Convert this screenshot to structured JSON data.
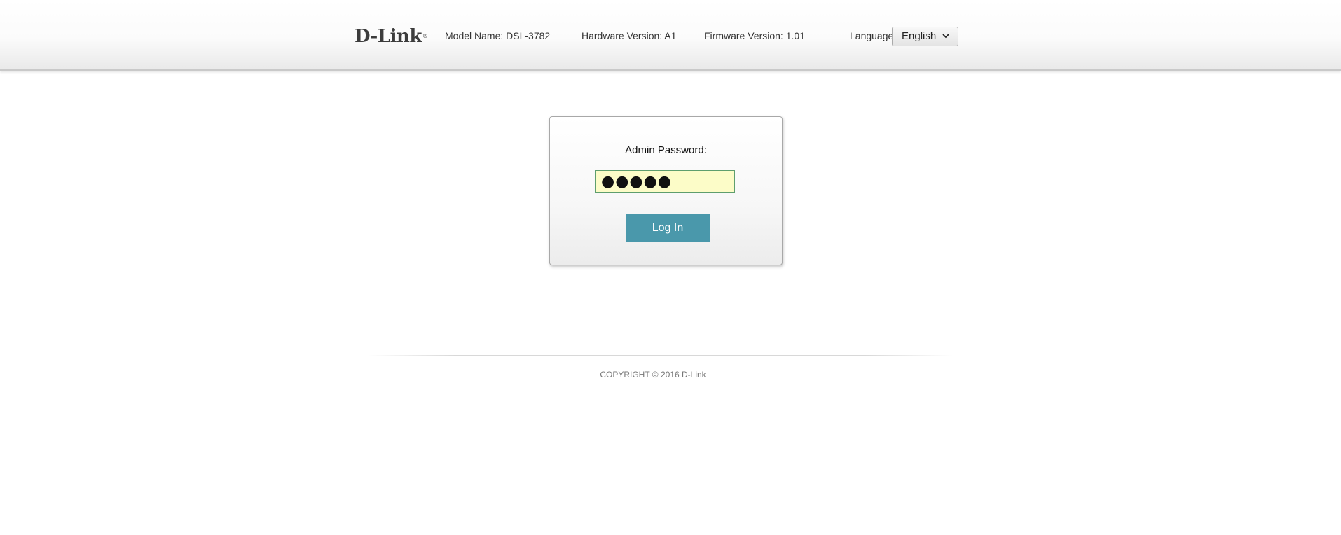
{
  "header": {
    "logo_text": "D-Link",
    "logo_mark": "®",
    "model_name": "Model Name: DSL-3782",
    "hardware_version": "Hardware Version: A1",
    "firmware_version": "Firmware Version: 1.01",
    "language_label": "Language:",
    "language_value": "English",
    "language_icon": "chevron-down-icon"
  },
  "login": {
    "password_label": "Admin Password:",
    "password_value": "●●●●●",
    "login_button": "Log In"
  },
  "footer": {
    "copyright": "COPYRIGHT © 2016 D-Link"
  },
  "colors": {
    "button": "#4a98ab",
    "input_bg": "#fcfcc8",
    "input_border": "#5e9e6e"
  }
}
